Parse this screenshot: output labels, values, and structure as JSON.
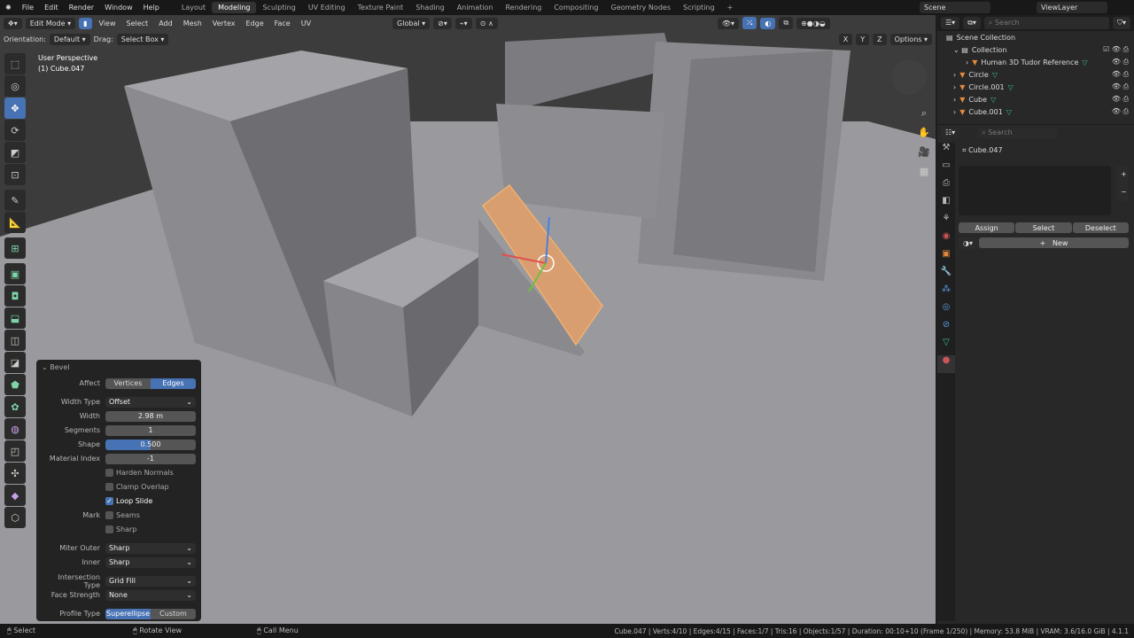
{
  "topbar": {
    "menus": [
      "File",
      "Edit",
      "Render",
      "Window",
      "Help"
    ],
    "workspaces": [
      "Layout",
      "Modeling",
      "Sculpting",
      "UV Editing",
      "Texture Paint",
      "Shading",
      "Animation",
      "Rendering",
      "Compositing",
      "Geometry Nodes",
      "Scripting"
    ],
    "active_workspace": "Modeling",
    "add_tab": "+",
    "scene": "Scene",
    "view_layer": "ViewLayer"
  },
  "header": {
    "mode": "Edit Mode",
    "menus": [
      "View",
      "Select",
      "Add",
      "Mesh",
      "Vertex",
      "Edge",
      "Face",
      "UV"
    ],
    "transform_orientation": "Global",
    "options": "Options",
    "axes": [
      "X",
      "Y",
      "Z"
    ]
  },
  "toolsettings": {
    "orientation_label": "Orientation:",
    "orientation": "Default",
    "drag_label": "Drag:",
    "drag": "Select Box"
  },
  "viewport": {
    "perspective": "User Perspective",
    "object": "(1) Cube.047"
  },
  "toolbar": {
    "icons": [
      "select-box-icon",
      "cursor-icon",
      "move-icon",
      "rotate-icon",
      "scale-icon",
      "transform-icon",
      "annotate-icon",
      "measure-icon",
      "add-cube-icon",
      "extrude-icon",
      "inset-icon",
      "bevel-icon",
      "loop-cut-icon",
      "knife-icon",
      "poly-build-icon",
      "spin-icon",
      "smooth-icon",
      "edge-slide-icon",
      "shrink-icon",
      "shear-icon",
      "rip-icon"
    ],
    "active": "move-icon"
  },
  "bevel": {
    "title": "Bevel",
    "affect_label": "Affect",
    "affect_options": [
      "Vertices",
      "Edges"
    ],
    "affect": "Edges",
    "width_type_label": "Width Type",
    "width_type": "Offset",
    "width_label": "Width",
    "width": "2.98 m",
    "segments_label": "Segments",
    "segments": "1",
    "shape_label": "Shape",
    "shape": "0.500",
    "material_index_label": "Material Index",
    "material_index": "-1",
    "harden_normals": "Harden Normals",
    "clamp_overlap": "Clamp Overlap",
    "loop_slide": "Loop Slide",
    "loop_slide_checked": true,
    "mark_label": "Mark",
    "seams": "Seams",
    "sharp": "Sharp",
    "miter_outer_label": "Miter Outer",
    "miter_outer": "Sharp",
    "inner_label": "Inner",
    "inner": "Sharp",
    "intersection_type_label": "Intersection Type",
    "intersection_type": "Grid Fill",
    "face_strength_label": "Face Strength",
    "face_strength": "None",
    "profile_type_label": "Profile Type",
    "profile_options": [
      "Superellipse",
      "Custom"
    ],
    "profile_type": "Superellipse"
  },
  "outliner": {
    "search_placeholder": "Search",
    "scene_collection": "Scene Collection",
    "collection": "Collection",
    "items": [
      "Human 3D Tudor Reference",
      "Circle",
      "Circle.001",
      "Cube",
      "Cube.001"
    ]
  },
  "properties": {
    "search_placeholder": "Search",
    "object": "Cube.047",
    "assign": "Assign",
    "select": "Select",
    "deselect": "Deselect",
    "new": "New"
  },
  "status": {
    "left": [
      "Select",
      "Rotate View",
      "Call Menu"
    ],
    "stats": "Cube.047 | Verts:4/10 | Edges:4/15 | Faces:1/7 | Tris:16 | Objects:1/57 | Duration: 00:10+10 (Frame 1/250) | Memory: 53.8 MiB | VRAM: 3.6/16.0 GiB | 4.1.1"
  },
  "colors": {
    "accent": "#4772b3",
    "selection": "#e8a060",
    "mesh_icon": "#3fbf8a",
    "object_icon": "#e08a3c"
  }
}
